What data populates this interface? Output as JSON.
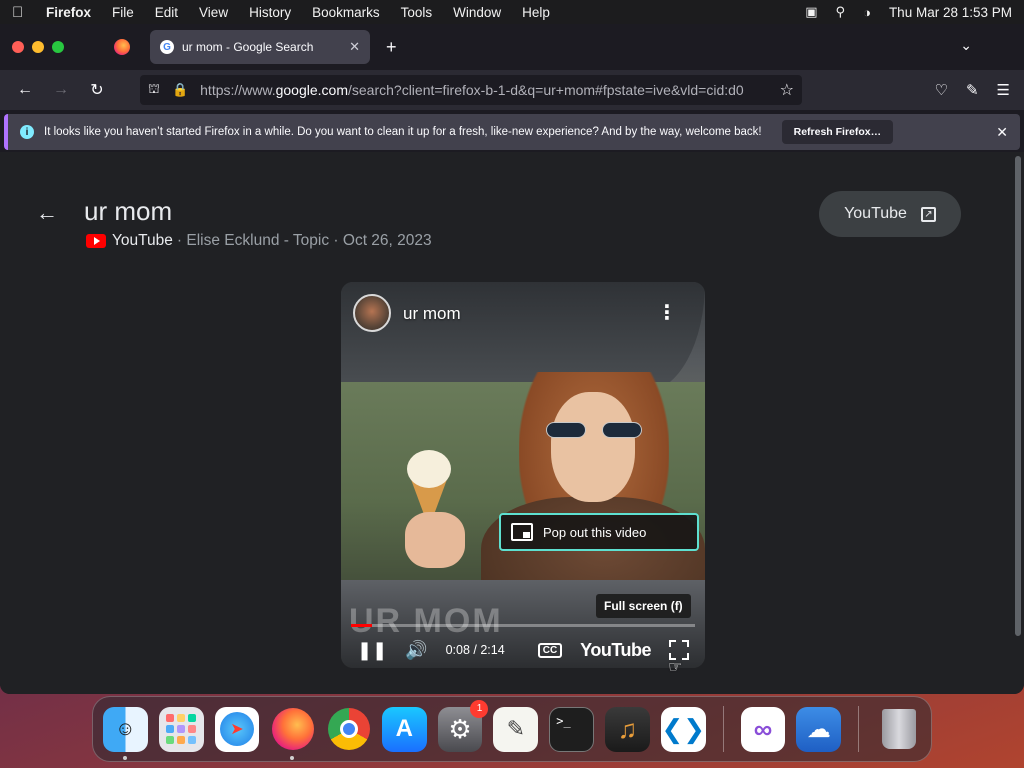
{
  "menubar": {
    "app_name": "Firefox",
    "items": [
      "File",
      "Edit",
      "View",
      "History",
      "Bookmarks",
      "Tools",
      "Window",
      "Help"
    ],
    "datetime": "Thu Mar 28  1:53 PM"
  },
  "browser": {
    "active_tab_title": "ur mom - Google Search",
    "url_prefix": "https://www.",
    "url_domain": "google.com",
    "url_rest": "/search?client=firefox-b-1-d&q=ur+mom#fpstate=ive&vld=cid:d0",
    "notification_text": "It looks like you haven’t started Firefox in a while. Do you want to clean it up for a fresh, like-new experience? And by the way, welcome back!",
    "refresh_label": "Refresh Firefox…"
  },
  "result": {
    "title": "ur mom",
    "source": "YouTube",
    "meta": "· Elise Ecklund - Topic · Oct 26, 2023",
    "youtube_button": "YouTube"
  },
  "video": {
    "title": "ur mom",
    "watermark": "UR MOM",
    "popout_label": "Pop out this video",
    "fullscreen_tooltip": "Full screen (f)",
    "time": "0:08 / 2:14",
    "progress_fraction": 0.06,
    "youtube_logo": "YouTube",
    "cc_label": "CC"
  },
  "dock": {
    "settings_badge": "1"
  }
}
